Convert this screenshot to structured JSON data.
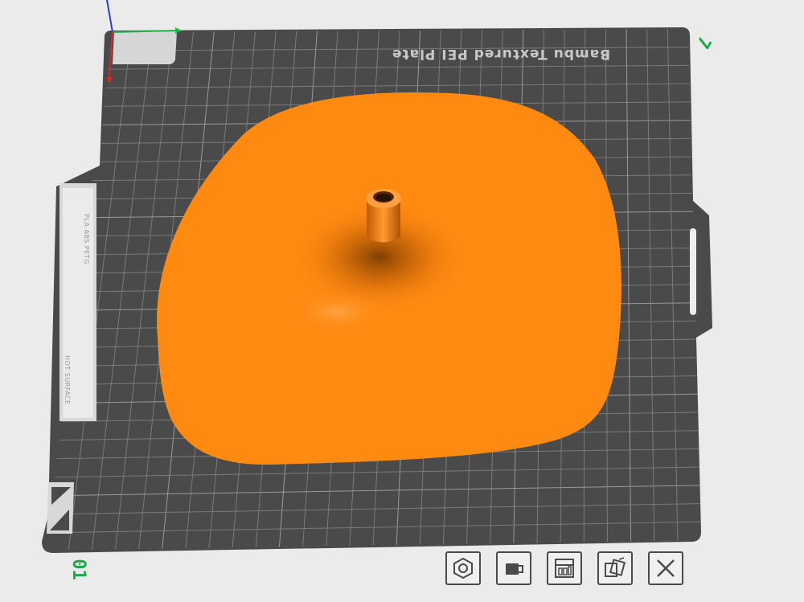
{
  "viewport": {
    "plate": {
      "name_label": "Bambu Textured PEI Plate",
      "plate_number": "01",
      "corner_mark": "7",
      "side_label": {
        "materials": "PLA ABS PETG",
        "warning": "HOT SURFACE"
      }
    },
    "model": {
      "color": "#ff8a12"
    },
    "axes": {
      "x_color": "#22b34a",
      "y_color": "#d42a2a",
      "z_color": "#2a3ad4"
    }
  },
  "toolbar": {
    "buttons": [
      {
        "name": "orient-button",
        "icon": "hexagon-icon"
      },
      {
        "name": "lock-button",
        "icon": "lock-plate-icon"
      },
      {
        "name": "arrange-button",
        "icon": "arrange-icon"
      },
      {
        "name": "auto-orient-button",
        "icon": "auto-orient-icon"
      },
      {
        "name": "delete-plate-button",
        "icon": "close-icon"
      }
    ]
  },
  "colors": {
    "background": "#ebebeb",
    "plate": "#4a4a4a",
    "grid": "#7a7a7a",
    "accent_green": "#1ea84a",
    "model_orange": "#ff8a12"
  }
}
